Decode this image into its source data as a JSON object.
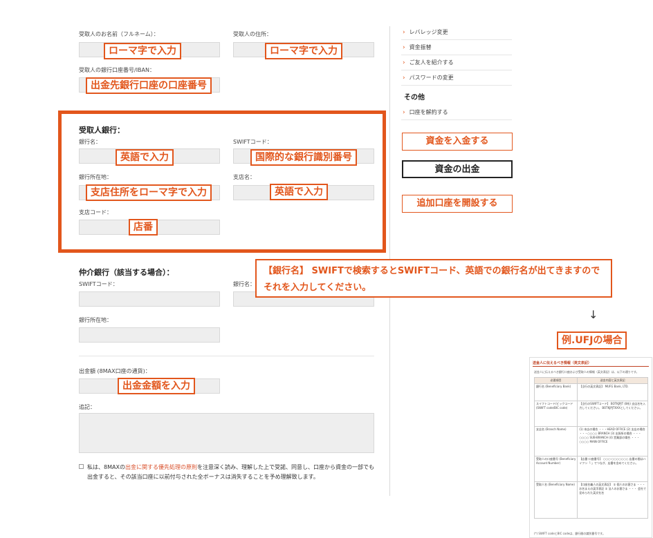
{
  "form": {
    "recipient_name_label": "受取人のお名前（フルネーム）：",
    "recipient_address_label": "受取人の住所：",
    "recipient_account_label": "受取人の銀行口座番号/IBAN：",
    "bank_section_title": "受取人銀行：",
    "bank_name_label": "銀行名：",
    "swift_label": "SWIFTコード：",
    "bank_address_label": "銀行所在地：",
    "branch_name_label": "支店名：",
    "branch_code_label": "支店コード：",
    "intermediary_title": "仲介銀行（該当する場合）：",
    "int_swift_label": "SWIFTコード：",
    "int_bank_name_label": "銀行名：",
    "int_bank_address_label": "銀行所在地：",
    "amount_label": "出金額 (8MAX口座の通貨)：",
    "remarks_label": "追記：",
    "consent": {
      "before": "私は、8MAXの",
      "link": "出金に関する優先処理の原則",
      "after": "を注意深く読み、理解した上で受諾、同意し、口座から資金の一部でも",
      "line2": "出金すると、その該当口座に以前付与された全ボーナスは消失することを予め理解致します。"
    }
  },
  "annotations": {
    "name_romaji": "ローマ字で入力",
    "address_romaji": "ローマ字で入力",
    "account_number": "出金先銀行口座の口座番号",
    "bank_name_en": "英語で入力",
    "swift_desc": "国際的な銀行識別番号",
    "branch_address_romaji": "支店住所をローマ字で入力",
    "branch_name_en": "英語で入力",
    "branch_code": "店番",
    "amount": "出金金額を入力",
    "note_line1": "【銀行名】 SWIFTで検索するとSWIFTコード、英語での銀行名が出てきますので",
    "note_line2": "それを入力してください。",
    "arrow": "↓",
    "example": "例.UFJの場合"
  },
  "sidebar": {
    "items": [
      "レバレッジ変更",
      "資金振替",
      "ご友人を紹介する",
      "パスワードの変更"
    ],
    "other_title": "その他",
    "other_items": [
      "口座を解約する"
    ],
    "deposit_button": "資金を入金する",
    "withdraw_button": "資金の出金",
    "open_account_button": "追加口座を開設する"
  },
  "example_doc": {
    "title": "送金人に伝えるべき情報（英文表記）",
    "subtitle": "送金人に伝えるべき銀行口座および受取人の情報（英文表記）は、以下の通りです。",
    "col1": "必要項目",
    "col2": "送金内容と英文表記",
    "rows": [
      {
        "k": "銀行名 (Beneficiary Bank)",
        "v": "【当行の英文表記】 MUFG Bank, LTD."
      },
      {
        "k": "スイフトコード/ビックコード (SWIFT code/BIC code)",
        "v": "【当行のSWIFTコード】 BOTKJPJT (8桁) 支店名を入力してください。 BOTKJPJTXXXとしてください。"
      },
      {
        "k": "支店名 (Branch Name)",
        "v": "(1) 本店の場合 ・・・HEAD OFFICE (2) 支店の場合 ・・・○○○○ BRANCH (3) 出張所の場合 ・・・○○○○ SUB-BRANCH (4) 営業部の場合 ・・・○○○○ MAIN OFFICE"
      },
      {
        "k": "受取人の口座番号 (Beneficiary Account Number)",
        "v": "【店番-口座番号】 ○○○-○○○○○○○ 店番の間はハイフン「-」でつなぎ、店番を含めてください。"
      },
      {
        "k": "受取人名 (Beneficiary Name)",
        "v": "【口座名義人の英文表記】 ① 個人のお客さま ・・・ お名まえの英字表記 ② 法人のお客さま ・・・ 会社で定められた英文社名"
      }
    ],
    "footer": "(*) SWIFT codeとBIC codeは、銀行間の識別番号です。"
  }
}
